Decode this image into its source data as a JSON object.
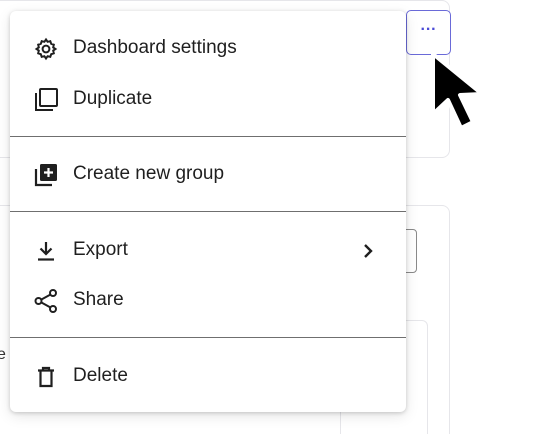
{
  "more_button": {
    "label": "···",
    "icon": "more-horizontal-icon"
  },
  "menu": {
    "items": [
      {
        "label": "Dashboard settings",
        "icon": "gear-icon"
      },
      {
        "label": "Duplicate",
        "icon": "duplicate-icon"
      },
      {
        "label": "Create new group",
        "icon": "add-group-icon"
      },
      {
        "label": "Export",
        "icon": "download-icon",
        "submenu": true
      },
      {
        "label": "Share",
        "icon": "share-icon"
      },
      {
        "label": "Delete",
        "icon": "trash-icon"
      }
    ]
  },
  "colors": {
    "accent": "#4b4bd6",
    "text": "#1f1f1f",
    "separator": "#6f6f6f"
  }
}
